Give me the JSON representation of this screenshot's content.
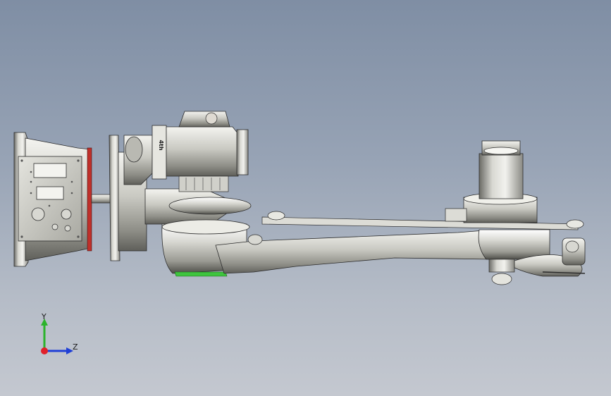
{
  "viewport": {
    "background_top": "#7f8ea4",
    "background_bottom": "#c4c8d0"
  },
  "model": {
    "description_icon": "robot-arm-model",
    "motor_label": "4th"
  },
  "triad": {
    "y_label": "Y",
    "z_label": "Z",
    "y_color": "#2bb32b",
    "z_color": "#1f3fd6",
    "x_color": "#e0202a"
  }
}
